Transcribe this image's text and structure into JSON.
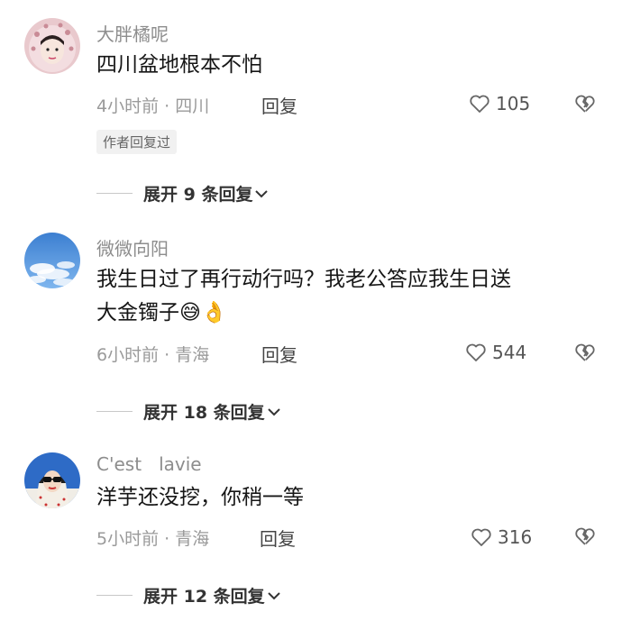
{
  "comments": [
    {
      "username": "大胖橘呢",
      "lines": [
        "四川盆地根本不怕"
      ],
      "emojis": [],
      "meta": "4小时前 · 四川",
      "reply_label": "回复",
      "likes": "105",
      "badge": "作者回复过",
      "expand": "展开 9 条回复",
      "avatar_icon": "girl-with-headscarf-avatar"
    },
    {
      "username": "微微向阳",
      "lines": [
        "我生日过了再行动行吗？我老公答应我生日送",
        "大金镯子"
      ],
      "emojis": [
        "😅",
        "👌"
      ],
      "meta": "6小时前 · 青海",
      "reply_label": "回复",
      "likes": "544",
      "badge": "",
      "expand": "展开 18 条回复",
      "avatar_icon": "blue-sky-avatar"
    },
    {
      "username": "C'est   lavie",
      "lines": [
        "洋芋还没挖，你稍一等"
      ],
      "emojis": [],
      "meta": "5小时前 · 青海",
      "reply_label": "回复",
      "likes": "316",
      "badge": "",
      "expand": "展开 12 条回复",
      "avatar_icon": "woman-with-sunglasses-avatar"
    }
  ],
  "icons": {
    "like": "heart-outline-icon",
    "dislike": "broken-heart-icon",
    "expand": "chevron-down-icon"
  },
  "colors": {
    "meta": "#9a9a9a",
    "username": "#8d8d8d",
    "text": "#161616"
  }
}
